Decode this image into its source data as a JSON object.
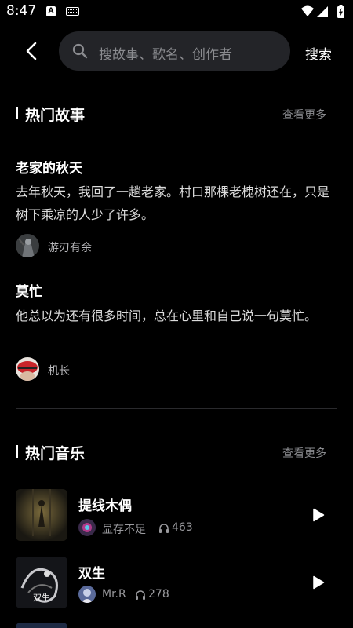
{
  "status_bar": {
    "time": "8:47",
    "app_badge": "A",
    "icons": [
      "wifi-icon",
      "signal-icon",
      "battery-charging-icon"
    ]
  },
  "header": {
    "back_icon": "chevron-left-icon",
    "search_placeholder": "搜故事、歌名、创作者",
    "search_button": "搜索"
  },
  "hot_stories": {
    "title": "热门故事",
    "more": "查看更多",
    "items": [
      {
        "title": "老家的秋天",
        "body": "去年秋天，我回了一趟老家。村口那棵老槐树还在，只是树下乘凉的人少了许多。",
        "author": "游刃有余"
      },
      {
        "title": "莫忙",
        "body": "他总以为还有很多时间，总在心里和自己说一句莫忙。",
        "author": "机长"
      }
    ]
  },
  "hot_music": {
    "title": "热门音乐",
    "more": "查看更多",
    "items": [
      {
        "title": "提线木偶",
        "artist": "显存不足",
        "listens": "463"
      },
      {
        "title": "双生",
        "artist": "Mr.R",
        "listens": "278",
        "cover_text": "双生"
      }
    ]
  },
  "colors": {
    "background": "#000000",
    "search_bg": "#232428",
    "muted_text": "#8a8b8f"
  }
}
